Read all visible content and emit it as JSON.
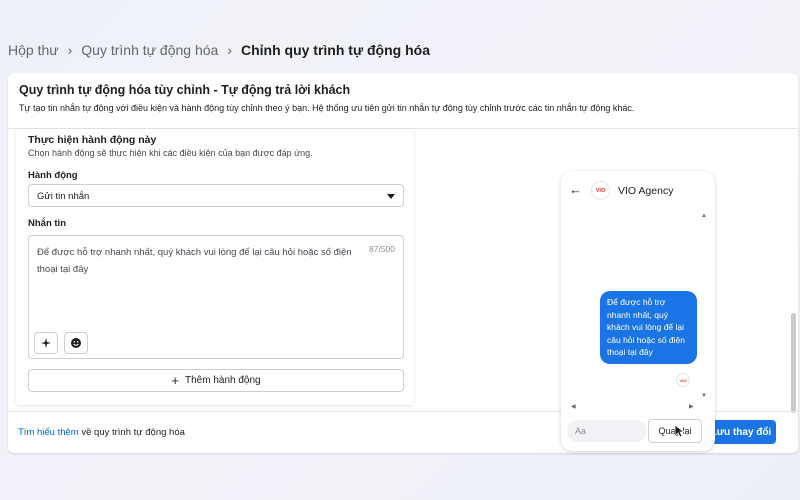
{
  "breadcrumb": {
    "items": [
      "Hộp thư",
      "Quy trình tự động hóa",
      "Chỉnh quy trình tự động hóa"
    ]
  },
  "card": {
    "title": "Quy trình tự động hóa tùy chỉnh - Tự động trả lời khách",
    "description": "Tự tạo tin nhắn tự động với điều kiện và hành động tùy chỉnh theo ý bạn. Hệ thống ưu tiên gửi tin nhắn tự động tùy chỉnh trước các tin nhắn tự động khác."
  },
  "action_section": {
    "title": "Thực hiện hành động này",
    "subtitle": "Chọn hành động sẽ thực hiện khi các điều kiện của bạn được đáp ứng.",
    "action_label": "Hành động",
    "action_value": "Gửi tin nhắn",
    "message_label": "Nhắn tin",
    "message_text": "Để được hỗ trợ nhanh nhất, quý khách vui lòng để lại câu hỏi hoặc số điện thoại tại đây",
    "char_count": "87/500",
    "add_action_label": "Thêm hành động"
  },
  "footer": {
    "learn_more_link": "Tìm hiểu thêm",
    "learn_more_rest": " về quy trình tự động hóa",
    "save_label": "Lưu thay đổi"
  },
  "preview": {
    "page_name": "VIO Agency",
    "avatar_text": "VIO",
    "bubble_text": "Để được hỗ trợ nhanh nhất, quý khách vui lòng để lại câu hỏi hoặc số điện thoại tại đây",
    "input_placeholder": "Aa",
    "back_button_label": "Quay lại"
  },
  "colors": {
    "accent": "#1b74e4",
    "link": "#0064d1",
    "brand_logo": "#e5322d"
  },
  "icons": {
    "breadcrumb_separator": "chevron-right-icon",
    "back": "arrow-left-icon",
    "personalize": "sparkle-icon",
    "emoji": "emoji-icon",
    "dropdown": "caret-down-icon",
    "cursor": "mouse-cursor-icon"
  }
}
